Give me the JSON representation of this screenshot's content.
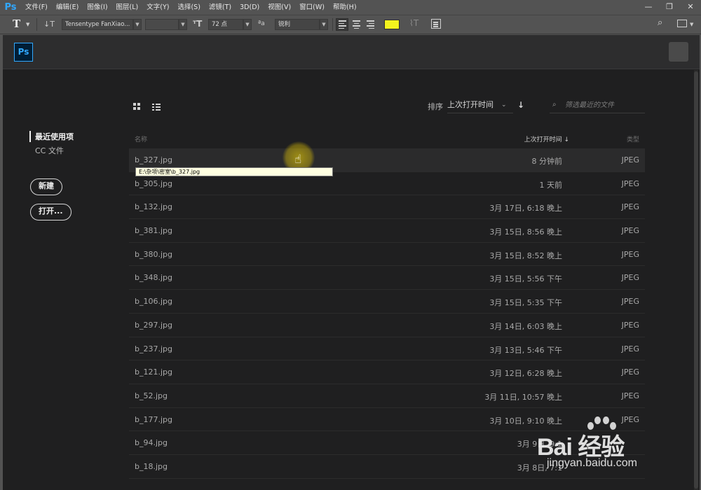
{
  "app": {
    "logo": "Ps"
  },
  "menu": [
    "文件(F)",
    "编辑(E)",
    "图像(I)",
    "图层(L)",
    "文字(Y)",
    "选择(S)",
    "滤镜(T)",
    "3D(D)",
    "视图(V)",
    "窗口(W)",
    "帮助(H)"
  ],
  "window_controls": {
    "minimize": "—",
    "restore": "❐",
    "close": "✕"
  },
  "options": {
    "tool_icon": "type-tool-icon",
    "font_family": "Tensentype FanXiao...",
    "font_style": "",
    "font_size": "72 点",
    "anti_alias": "锐利",
    "text_color": "#f2f21e",
    "align_active": "left"
  },
  "start": {
    "logo": "Ps",
    "sidebar": {
      "recent": "最近使用项",
      "cc_files": "CC 文件",
      "new_button": "新建",
      "open_button": "打开..."
    },
    "toolbar": {
      "sort_label": "排序",
      "sort_value": "上次打开时间",
      "filter_placeholder": "筛选最近的文件"
    },
    "table": {
      "headers": {
        "name": "名称",
        "date": "上次打开时间 ↓",
        "type": "类型"
      },
      "rows": [
        {
          "name": "b_327.jpg",
          "date": "8 分钟前",
          "type": "JPEG"
        },
        {
          "name": "b_305.jpg",
          "date": "1 天前",
          "type": "JPEG"
        },
        {
          "name": "b_132.jpg",
          "date": "3月 17日, 6:18 晚上",
          "type": "JPEG"
        },
        {
          "name": "b_381.jpg",
          "date": "3月 15日, 8:56 晚上",
          "type": "JPEG"
        },
        {
          "name": "b_380.jpg",
          "date": "3月 15日, 8:52 晚上",
          "type": "JPEG"
        },
        {
          "name": "b_348.jpg",
          "date": "3月 15日, 5:56 下午",
          "type": "JPEG"
        },
        {
          "name": "b_106.jpg",
          "date": "3月 15日, 5:35 下午",
          "type": "JPEG"
        },
        {
          "name": "b_297.jpg",
          "date": "3月 14日, 6:03 晚上",
          "type": "JPEG"
        },
        {
          "name": "b_237.jpg",
          "date": "3月 13日, 5:46 下午",
          "type": "JPEG"
        },
        {
          "name": "b_121.jpg",
          "date": "3月 12日, 6:28 晚上",
          "type": "JPEG"
        },
        {
          "name": "b_52.jpg",
          "date": "3月 11日, 10:57 晚上",
          "type": "JPEG"
        },
        {
          "name": "b_177.jpg",
          "date": "3月 10日, 9:10 晚上",
          "type": "JPEG"
        },
        {
          "name": "b_94.jpg",
          "date": "3月 9日, 9:1",
          "type": ""
        },
        {
          "name": "b_18.jpg",
          "date": "3月 8日, 7:1",
          "type": ""
        }
      ]
    },
    "tooltip": "E:\\杂项\\密室\\b_327.jpg"
  },
  "watermark": {
    "brand": "Bai 经验",
    "url": "jingyan.baidu.com"
  }
}
